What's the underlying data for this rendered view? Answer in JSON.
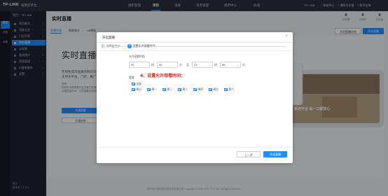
{
  "app": {
    "logo": "TP-LINK",
    "product": "商用云平台",
    "nav": [
      "组织管理",
      "项目",
      "设备",
      "消息管理",
      "费用中心",
      "商城"
    ],
    "nav_active_index": 1,
    "top_right": [
      "TP-LINK",
      "□ 帮助中心",
      "□ 通知与反馈",
      "□ 账号名称"
    ]
  },
  "sidebar": {
    "rail": [
      "概览",
      "设备",
      "消息"
    ],
    "header": "项目：TP-LINK",
    "items": [
      {
        "label": "项目概览",
        "active": false
      },
      {
        "label": "设备总览",
        "active": false
      },
      {
        "label": "门店列表",
        "active": false
      },
      {
        "label": "实时直播",
        "active": true
      },
      {
        "label": "云存储",
        "active": false
      },
      {
        "label": "客流统计",
        "active": false
      },
      {
        "label": "消息管理",
        "active": false
      },
      {
        "label": "AI智能服务",
        "active": false
      },
      {
        "label": "设置",
        "active": false
      }
    ],
    "footer": [
      "退出",
      "版本号 V 1.1.0"
    ]
  },
  "page": {
    "title": "实时直播",
    "stats": [
      {
        "num": "0",
        "label": "已开播"
      },
      {
        "num": "0",
        "label": "已预约"
      },
      {
        "num": "0",
        "label": "已结束"
      }
    ],
    "tabs": [
      "直播列表",
      "数据统计",
      "H5模板"
    ],
    "buttons": [
      "开启直播计划",
      "开启直播"
    ]
  },
  "background": {
    "title": "实时直播",
    "lines": [
      "在线生成可直播的网页页面，",
      "支持多平台，门店，推广等"
    ],
    "notes": [
      "说明：",
      "使用本功能需要开启设备的直播功能，",
      "设置直播时间，生成直播页面链接后即可进行分享"
    ],
    "buttons": [
      "开通直播",
      "开通说明"
    ],
    "phone_banner": "新店开业  每一口都放心"
  },
  "modal": {
    "title": "开启直播",
    "close": "×",
    "steps": [
      {
        "num": "✓",
        "label": "选择监控点"
      },
      {
        "num": "2",
        "label": "设置允许观看时间"
      }
    ],
    "time_section_label": "允许观看时段",
    "time": {
      "from_hour": "00",
      "from_minute": "00",
      "to_hour": "23",
      "to_minute": "59",
      "hour_unit": "时",
      "minute_unit": "分",
      "separator": "至"
    },
    "days_section_label": "重复",
    "all_label": "全部",
    "days": [
      "周日",
      "周一",
      "周二",
      "周三",
      "周四",
      "周五",
      "周六"
    ],
    "buttons": {
      "prev": "上一步",
      "finish": "开启直播"
    }
  },
  "annotation": "4、设置允许观看时间；",
  "footer": "深圳市中商网络信息科技有限公司 Copyright © 2019-2022 TP-LINK. All rights reserved.",
  "colors": {
    "accent": "#1e90ff",
    "topbar": "#2a2f3a",
    "sidebar": "#1f2430",
    "annotation": "#e2221b"
  }
}
